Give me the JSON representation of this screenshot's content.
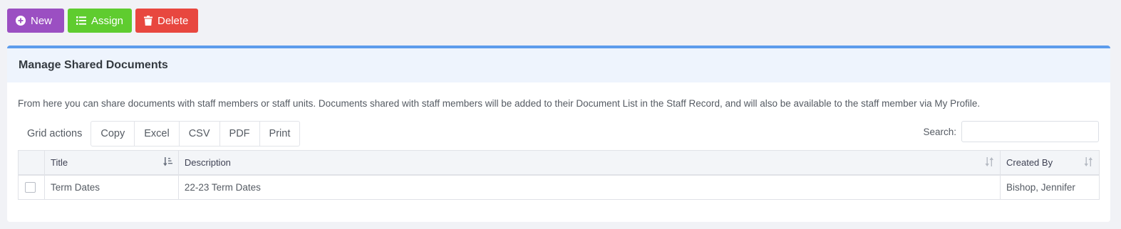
{
  "toolbar": {
    "new_label": "New",
    "assign_label": "Assign",
    "delete_label": "Delete",
    "colors": {
      "new": "#9b4fc2",
      "assign": "#5fcc2f",
      "delete": "#e8473f"
    }
  },
  "card": {
    "title": "Manage Shared Documents",
    "intro": "From here you can share documents with staff members or staff units. Documents shared with staff members will be added to their Document List in the Staff Record, and will also be available to the staff member via My Profile."
  },
  "grid_actions": {
    "label": "Grid actions",
    "buttons": [
      "Copy",
      "Excel",
      "CSV",
      "PDF",
      "Print"
    ]
  },
  "search": {
    "label": "Search:",
    "value": ""
  },
  "table": {
    "columns": [
      "Title",
      "Description",
      "Created By"
    ],
    "rows": [
      {
        "title": "Term Dates",
        "description": "22-23 Term Dates",
        "created_by": "Bishop, Jennifer"
      }
    ]
  }
}
